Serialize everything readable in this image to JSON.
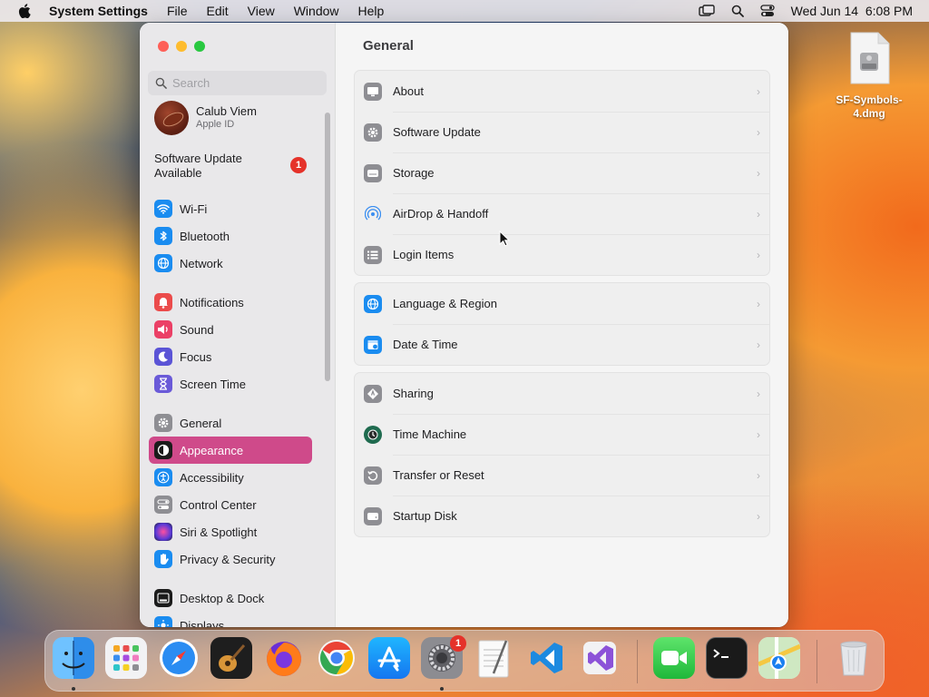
{
  "menubar": {
    "app": "System Settings",
    "items": [
      "File",
      "Edit",
      "View",
      "Window",
      "Help"
    ],
    "clock": "Wed Jun 14  6:08 PM"
  },
  "window": {
    "search_placeholder": "Search",
    "account": {
      "name": "Calub Viem",
      "sub": "Apple ID"
    },
    "update": {
      "label": "Software Update Available",
      "badge": "1"
    },
    "sidebar": [
      {
        "label": "Wi-Fi",
        "icon": "wifi-icon",
        "color": "#1a8cf0"
      },
      {
        "label": "Bluetooth",
        "icon": "bluetooth-icon",
        "color": "#1a8cf0"
      },
      {
        "label": "Network",
        "icon": "globe-icon",
        "color": "#1a8cf0"
      },
      {
        "label": "Notifications",
        "icon": "bell-icon",
        "color": "#eb4b4b"
      },
      {
        "label": "Sound",
        "icon": "speaker-icon",
        "color": "#eb4066"
      },
      {
        "label": "Focus",
        "icon": "moon-icon",
        "color": "#5b54d6"
      },
      {
        "label": "Screen Time",
        "icon": "hourglass-icon",
        "color": "#6a5ad8"
      },
      {
        "label": "General",
        "icon": "gear-icon",
        "color": "#8e8e93"
      },
      {
        "label": "Appearance",
        "icon": "appearance-icon",
        "color": "#1b1b1b"
      },
      {
        "label": "Accessibility",
        "icon": "accessibility-icon",
        "color": "#1a8cf0"
      },
      {
        "label": "Control Center",
        "icon": "switches-icon",
        "color": "#8e8e93"
      },
      {
        "label": "Siri & Spotlight",
        "icon": "siri-icon",
        "color": "#7b3fc8"
      },
      {
        "label": "Privacy & Security",
        "icon": "hand-icon",
        "color": "#1a8cf0"
      },
      {
        "label": "Desktop & Dock",
        "icon": "dock-icon",
        "color": "#1b1b1b"
      },
      {
        "label": "Displays",
        "icon": "sun-icon",
        "color": "#1a8cf0"
      }
    ],
    "main_title": "General",
    "groups": [
      [
        {
          "label": "About",
          "icon": "display-icon"
        },
        {
          "label": "Software Update",
          "icon": "gear-badge-icon"
        },
        {
          "label": "Storage",
          "icon": "drive-icon"
        },
        {
          "label": "AirDrop & Handoff",
          "icon": "airdrop-icon"
        },
        {
          "label": "Login Items",
          "icon": "list-icon"
        }
      ],
      [
        {
          "label": "Language & Region",
          "icon": "globe-icon"
        },
        {
          "label": "Date & Time",
          "icon": "calendar-icon"
        }
      ],
      [
        {
          "label": "Sharing",
          "icon": "sharing-icon"
        },
        {
          "label": "Time Machine",
          "icon": "time-machine-icon"
        },
        {
          "label": "Transfer or Reset",
          "icon": "reset-icon"
        },
        {
          "label": "Startup Disk",
          "icon": "disk-icon"
        }
      ]
    ]
  },
  "desktop": {
    "file_label": "SF-Symbols-4.dmg"
  },
  "dock": {
    "apps": [
      "Finder",
      "Launchpad",
      "Safari",
      "GarageBand",
      "Firefox",
      "Chrome",
      "App Store",
      "System Settings",
      "TextEdit",
      "Visual Studio Code",
      "Visual Studio",
      "FaceTime",
      "Terminal",
      "Maps",
      "Trash"
    ],
    "settings_badge": "1"
  },
  "colors": {
    "accent": "#cf4a8a",
    "badge": "#e5322a"
  }
}
